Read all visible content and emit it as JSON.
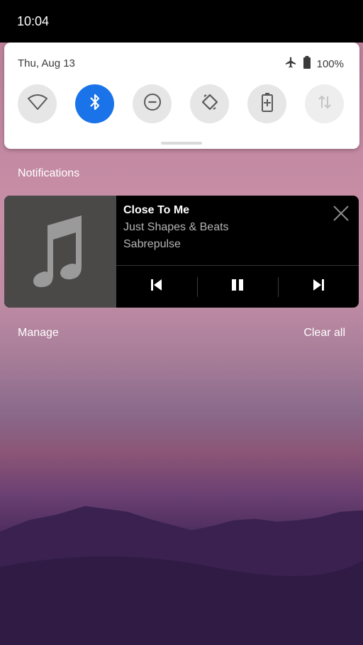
{
  "status_bar": {
    "time": "10:04"
  },
  "quick_settings": {
    "date": "Thu, Aug 13",
    "battery_percent": "100%",
    "tiles": [
      {
        "name": "wifi",
        "icon": "wifi-icon",
        "active": false
      },
      {
        "name": "bluetooth",
        "icon": "bluetooth-icon",
        "active": true
      },
      {
        "name": "do-not-disturb",
        "icon": "do-not-disturb-icon",
        "active": false
      },
      {
        "name": "auto-rotate",
        "icon": "auto-rotate-icon",
        "active": false
      },
      {
        "name": "battery-saver",
        "icon": "battery-saver-icon",
        "active": false
      },
      {
        "name": "mobile-data",
        "icon": "mobile-data-icon",
        "active": false,
        "disabled": true
      }
    ],
    "accent_color": "#1a73e8"
  },
  "notifications": {
    "header": "Notifications",
    "media": {
      "title": "Close To Me",
      "album": "Just Shapes & Beats",
      "artist": "Sabrepulse",
      "art_icon": "music-note-icon",
      "controls": [
        "previous-icon",
        "pause-icon",
        "next-icon"
      ]
    },
    "manage_label": "Manage",
    "clear_all_label": "Clear all"
  }
}
